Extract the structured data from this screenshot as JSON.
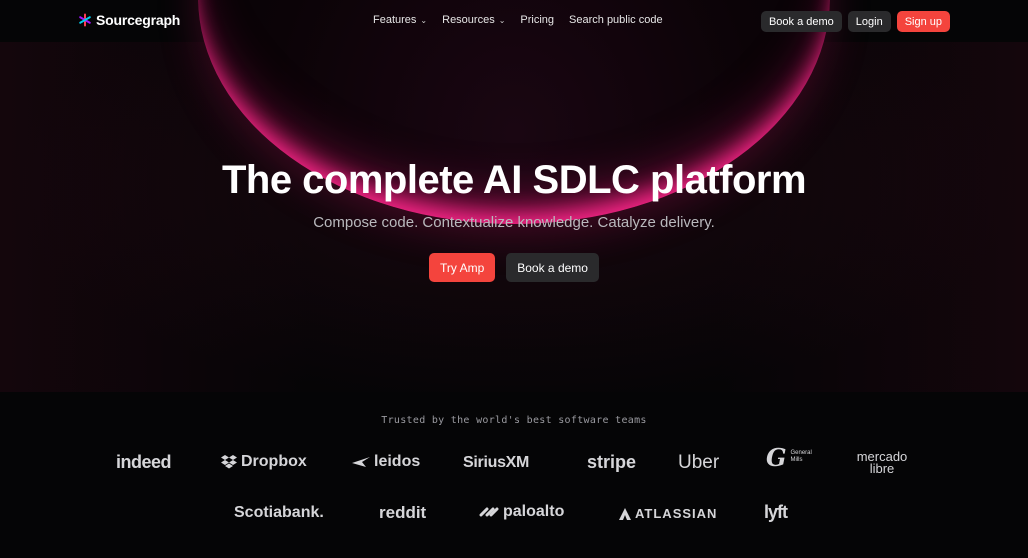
{
  "nav": {
    "brand": "Sourcegraph",
    "links": [
      {
        "label": "Features",
        "has_dropdown": true
      },
      {
        "label": "Resources",
        "has_dropdown": true
      },
      {
        "label": "Pricing",
        "has_dropdown": false
      },
      {
        "label": "Search public code",
        "has_dropdown": false
      }
    ],
    "book_demo": "Book a demo",
    "login": "Login",
    "signup": "Sign up"
  },
  "hero": {
    "title": "The complete AI SDLC platform",
    "subtitle": "Compose code. Contextualize knowledge. Catalyze delivery.",
    "primary_cta": "Try Amp",
    "secondary_cta": "Book a demo"
  },
  "trusted": {
    "heading": "Trusted by the world's best software teams",
    "logos_row1": [
      "indeed",
      "Dropbox",
      "leidos",
      "SiriusXM",
      "stripe",
      "Uber",
      "General Mills",
      "mercado libre"
    ],
    "logos_row2": [
      "Scotiabank.",
      "reddit",
      "paloalto",
      "ATLASSIAN",
      "lyft"
    ]
  },
  "colors": {
    "background": "#050506",
    "accent_red": "#f4443d",
    "dark_button": "#2a2a2c",
    "glow_pink": "#ff288c"
  }
}
